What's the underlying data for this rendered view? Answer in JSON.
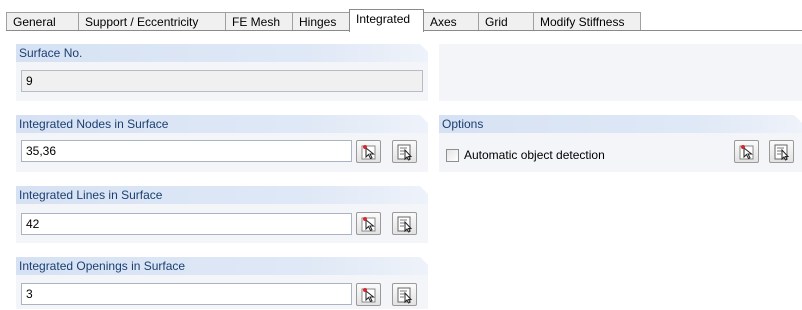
{
  "tabs": [
    {
      "label": "General"
    },
    {
      "label": "Support / Eccentricity"
    },
    {
      "label": "FE Mesh"
    },
    {
      "label": "Hinges"
    },
    {
      "label": "Integrated",
      "active": true
    },
    {
      "label": "Axes"
    },
    {
      "label": "Grid"
    },
    {
      "label": "Modify Stiffness"
    }
  ],
  "surface_no": {
    "title": "Surface No.",
    "value": "9"
  },
  "nodes": {
    "title": "Integrated Nodes in Surface",
    "value": "35,36"
  },
  "lines": {
    "title": "Integrated Lines in Surface",
    "value": "42"
  },
  "openings": {
    "title": "Integrated Openings in Surface",
    "value": "3"
  },
  "options": {
    "title": "Options",
    "auto_detect_label": "Automatic object detection",
    "auto_detect_checked": false
  },
  "colors": {
    "header_bg": "#d6e2f4",
    "header_text": "#1c3f6f",
    "panel_bg": "#f3f5f9"
  },
  "icons": [
    "pick-single-icon",
    "pick-list-icon"
  ]
}
